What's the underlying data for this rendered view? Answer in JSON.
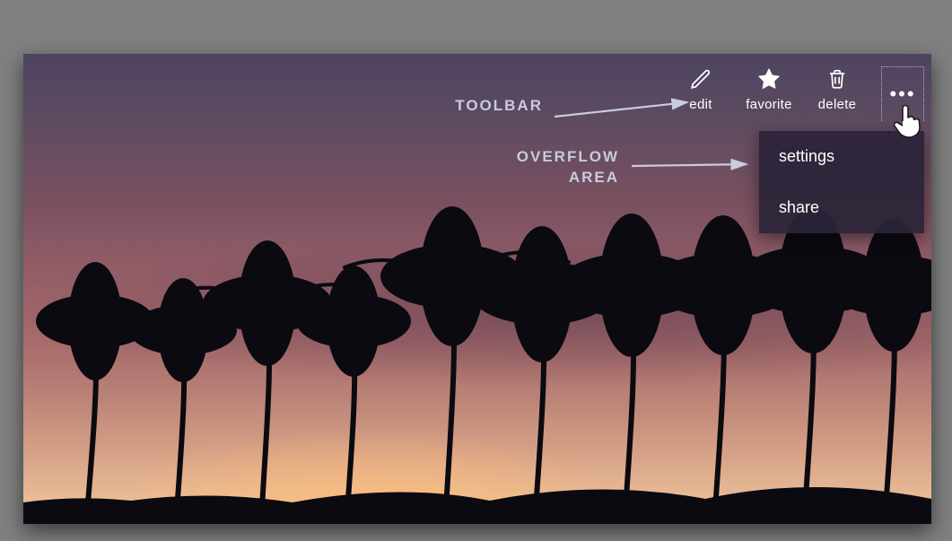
{
  "annotations": {
    "toolbar_label": "TOOLBAR",
    "overflow_label_1": "OVERFLOW",
    "overflow_label_2": "AREA"
  },
  "toolbar": {
    "edit_label": "edit",
    "favorite_label": "favorite",
    "delete_label": "delete",
    "more_icon_name": "more-icon"
  },
  "overflow_menu": {
    "items": [
      {
        "label": "settings"
      },
      {
        "label": "share"
      }
    ]
  }
}
